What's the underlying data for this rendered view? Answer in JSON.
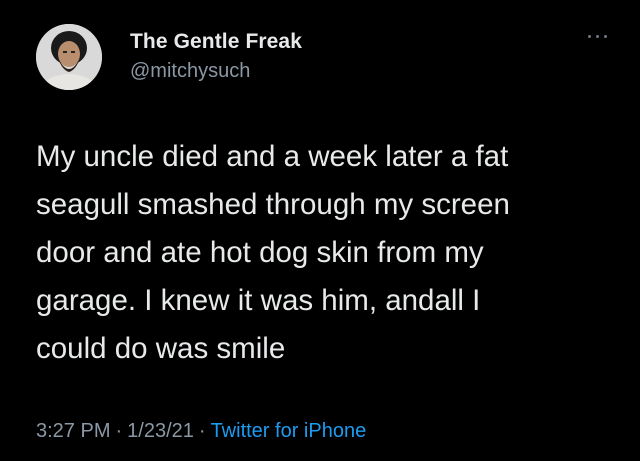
{
  "author": {
    "display_name": "The Gentle Freak",
    "handle": "@mitchysuch",
    "avatar_icon": "user-avatar"
  },
  "menu": {
    "icon": "more-options-icon"
  },
  "tweet": {
    "text": "My uncle died and a week later a fat\nseagull smashed through my screen\ndoor and ate hot dog skin from my\ngarage. I  knew it was him, andall I\ncould do was smile"
  },
  "meta": {
    "time": "3:27 PM",
    "separator": "·",
    "date": "1/23/21",
    "source": "Twitter for iPhone"
  },
  "colors": {
    "background": "#000000",
    "primary_text": "#e7e9ea",
    "secondary_text": "#8b98a5",
    "link": "#1d9bf0"
  }
}
